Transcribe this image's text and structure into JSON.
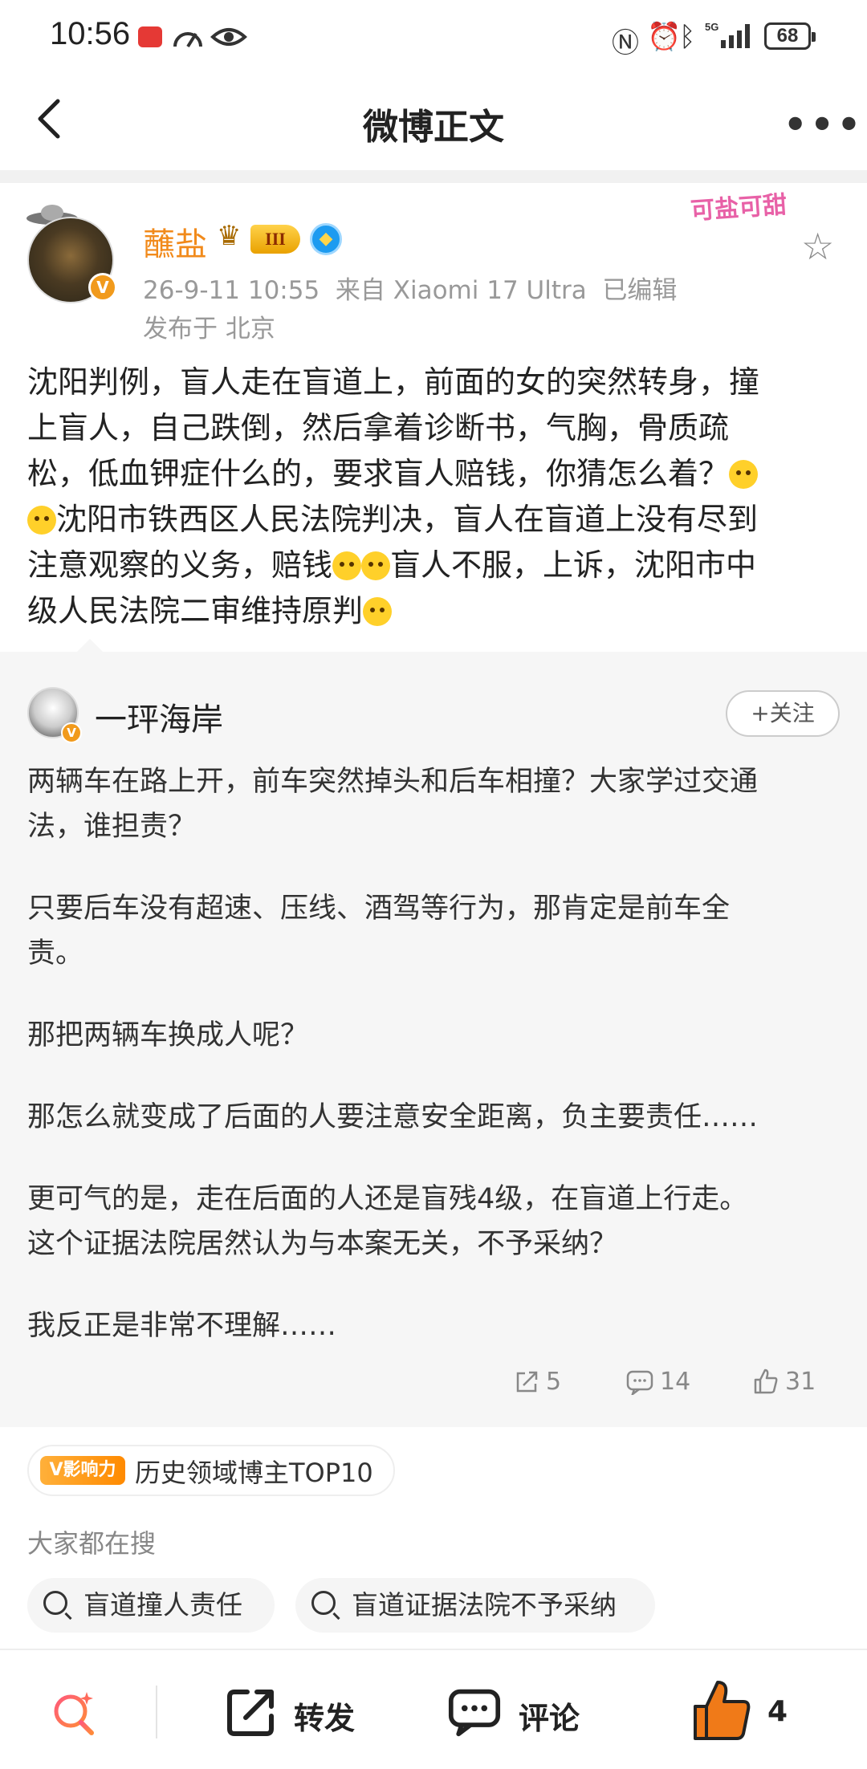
{
  "status_bar": {
    "time": "10:56",
    "battery": "68"
  },
  "nav": {
    "title": "微博正文",
    "more": "•••"
  },
  "post": {
    "username": "蘸盐",
    "level": "III",
    "time_source": "26-9-11 10:55  来自 Xiaomi 17 Ultra  已编辑",
    "location": "发布于 北京",
    "sticker_text": "可盐可甜",
    "content": [
      "沈阳判例，盲人走在盲道上，前面的女的突然转身，撞",
      "上盲人，自己跌倒，然后拿着诊断书，气胸，骨质疏",
      "松，低血钾症什么的，要求盲人赔钱，你猜怎么着？",
      "沈阳市铁西区人民法院判决，盲人在盲道上没有尽到",
      "注意观察的义务，赔钱",
      "盲人不服，上诉，沈阳市中",
      "级人民法院二审维持原判"
    ]
  },
  "repost": {
    "username": "一玶海岸",
    "follow_label": "+关注",
    "paragraphs": [
      "两辆车在路上开，前车突然掉头和后车相撞？大家学过交通",
      "法，谁担责？",
      "只要后车没有超速、压线、酒驾等行为，那肯定是前车全",
      "责。",
      "那把两辆车换成人呢？",
      "那怎么就变成了后面的人要注意安全距离，负主要责任……",
      "更可气的是，走在后面的人还是盲残4级，在盲道上行走。",
      "这个证据法院居然认为与本案无关，不予采纳？",
      "我反正是非常不理解……"
    ],
    "reposts": "5",
    "comments": "14",
    "likes": "31"
  },
  "influence": {
    "badge": "V影响力",
    "text": "历史领域博主TOP10"
  },
  "trending": {
    "heading": "大家都在搜",
    "chips": [
      "盲道撞人责任",
      "盲道证据法院不予采纳"
    ]
  },
  "bottom_bar": {
    "repost_label": "转发",
    "comment_label": "评论",
    "like_count": "4"
  },
  "colors": {
    "accent_orange": "#f18a1b",
    "like_orange": "#f07a18",
    "verified_blue": "#1d9bf0"
  }
}
